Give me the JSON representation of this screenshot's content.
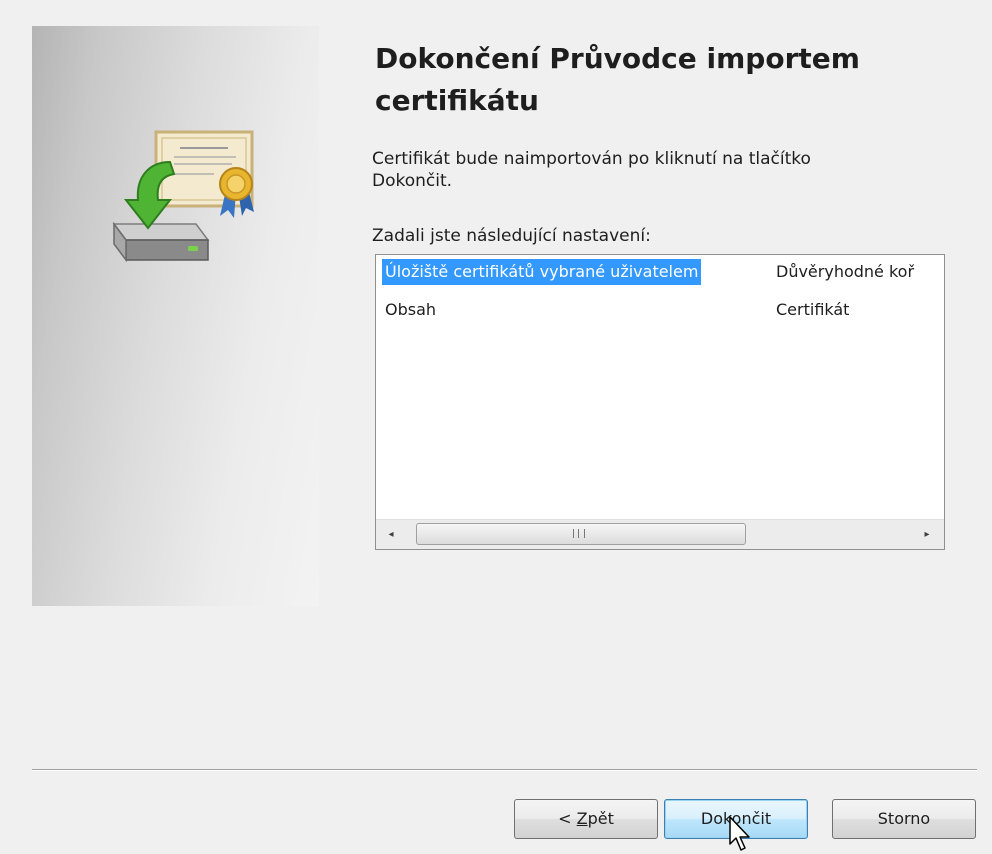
{
  "wizard": {
    "title": "Dokončení Průvodce importem certifikátu",
    "description": "Certifikát bude naimportován po kliknutí na tlačítko Dokončit.",
    "settings_label": "Zadali jste následující nastavení:"
  },
  "settings_list": {
    "rows": [
      {
        "name": "Úložiště certifikátů vybrané uživatelem",
        "value": "Důvěryhodné koř",
        "selected": true
      },
      {
        "name": "Obsah",
        "value": "Certifikát",
        "selected": false
      }
    ],
    "scrollbar": {
      "left_arrow": "◂",
      "right_arrow": "▸"
    }
  },
  "buttons": {
    "back_label": "< Zpět",
    "back_accesskey": "Z",
    "finish_label": "Dokončit",
    "cancel_label": "Storno"
  },
  "colors": {
    "selection": "#3399ff",
    "background": "#f0f0f0",
    "default_button_border": "#3c7fb1"
  },
  "icons": {
    "wizard_art": "certificate-import-icon",
    "cursor": "mouse-pointer-icon"
  }
}
